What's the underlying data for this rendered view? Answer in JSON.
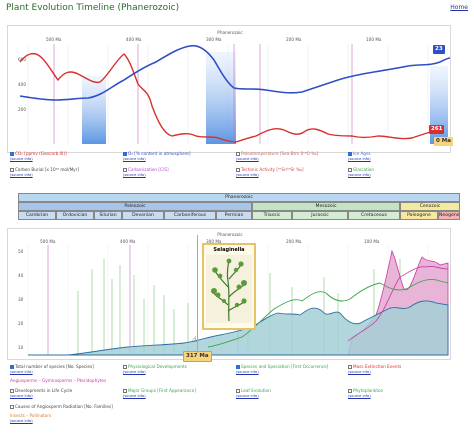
{
  "page": {
    "title": "Plant Evolution Timeline (Phanerozoic)",
    "home_link": "Home"
  },
  "top_chart": {
    "era_label": "Phanerozoic",
    "ticks": [
      "500 Ma",
      "400 Ma",
      "300 Ma",
      "200 Ma",
      "100 Ma"
    ],
    "y_ticks": [
      "600",
      "400",
      "200"
    ],
    "co2_badge": "261",
    "o2_badge": "23",
    "ma_badge": "0 Ma",
    "checkboxes": [
      {
        "label": "CO₂ [ppmv (Geocarb III)]",
        "checked": true,
        "color": "#d8302e",
        "link": "(source info)"
      },
      {
        "label": "O₂ [% content in atmosphere]",
        "checked": true,
        "color": "#2f4fc8",
        "link": "(source info)"
      },
      {
        "label": "Paleotemperature [Sea-Btm δ¹⁸O ‰]",
        "checked": false,
        "color": "#c86b6b",
        "link": "(source info)"
      },
      {
        "label": "Ice Ages",
        "checked": true,
        "color": "#3a7bd5",
        "link": "(source info)"
      },
      {
        "label": "Carbon Burial [x 10¹⁸ mol/Myr]",
        "checked": false,
        "color": "#555555",
        "link": "(source info)"
      },
      {
        "label": "Carbonization [C/S]",
        "checked": false,
        "color": "#b44ac8",
        "link": "(source info)"
      },
      {
        "label": "Tectonic Activity [⁸⁷Sr/⁸⁶Sr ‰]",
        "checked": false,
        "color": "#c84a4a",
        "link": "(source info)"
      },
      {
        "label": "Glaciation",
        "checked": false,
        "color": "#3aa54a",
        "link": "(source info)"
      }
    ]
  },
  "timeline": {
    "eon": "Phanerozoic",
    "eras": [
      "Paleozoic",
      "Mesozoic",
      "Cenozoic"
    ],
    "periods": [
      "Cambrian",
      "Ordovician",
      "Silurian",
      "Devonian",
      "Carboniferous",
      "Permian",
      "Triassic",
      "Jurassic",
      "Cretaceous",
      "Paleogene",
      "Neogene"
    ]
  },
  "bottom_chart": {
    "era_label": "Phanerozoic",
    "ticks": [
      "500 Ma",
      "400 Ma",
      "300 Ma",
      "200 Ma",
      "100 Ma"
    ],
    "y_ticks": [
      "50",
      "40",
      "30",
      "20",
      "10"
    ],
    "cursor_badge": "317 Ma",
    "popup_title": "Selaginella",
    "checkboxes": [
      {
        "label": "Total number of species [No. Species]",
        "checked": true,
        "color": "#2f6f9f",
        "link": "(source info)"
      },
      {
        "label": "Physiological Developments",
        "checked": false,
        "color": "#3aa54a",
        "link": "(source info)"
      },
      {
        "label": "Species and Speciation [First Occurrence]",
        "checked": true,
        "color": "#3aa54a",
        "link": "(source info)"
      },
      {
        "label": "Mass Extinction Events",
        "checked": false,
        "color": "#d8302e",
        "link": "(source info)"
      },
      {
        "label": "Angiosperms – Gymnosperms – Pteridophytes",
        "checked": false,
        "color": "#c83aa0",
        "link": ""
      },
      {
        "label": "Developments in Life Cycle",
        "checked": false,
        "color": "#444444",
        "link": "(source info)"
      },
      {
        "label": "Major Groups [First Appearance]",
        "checked": false,
        "color": "#3aa54a",
        "link": "(source info)"
      },
      {
        "label": "Leaf Evolution",
        "checked": false,
        "color": "#3aa54a",
        "link": "(source info)"
      },
      {
        "label": "Phytoplankton",
        "checked": false,
        "color": "#3aa54a",
        "link": "(source info)"
      },
      {
        "label": "Causes of Angiosperm Radiation [No. Families]",
        "checked": false,
        "color": "#444444",
        "link": ""
      },
      {
        "label": "Insects – Pollinators",
        "checked": false,
        "color": "#d87a2e",
        "link": "(source info)"
      }
    ]
  }
}
